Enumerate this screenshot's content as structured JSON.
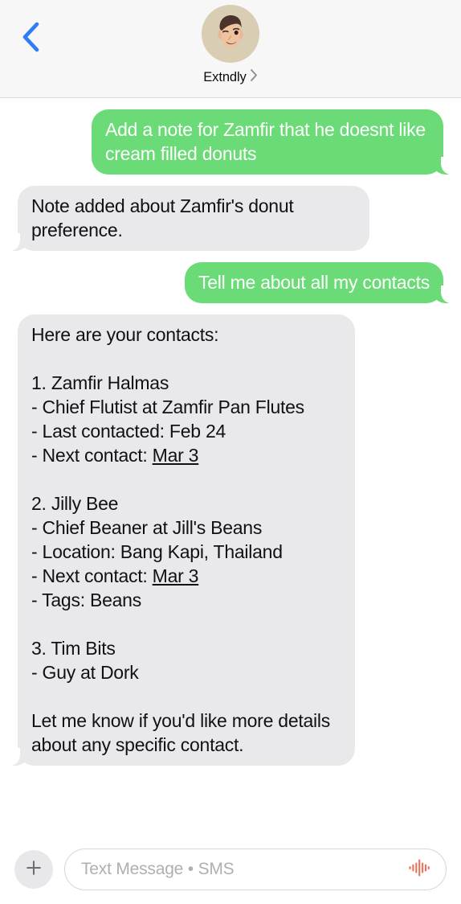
{
  "header": {
    "back_icon": "chevron-left-icon",
    "back_color": "#2F7CF6",
    "avatar_icon": "memoji-avatar",
    "avatar_bg": "#D9CDB3",
    "contact_name": "Extndly",
    "detail_chevron_icon": "chevron-right-icon"
  },
  "conversation": {
    "messages": [
      {
        "id": "msg-1",
        "direction": "outgoing",
        "service": "SMS",
        "text": "Add a note for Zamfir that he doesnt like cream filled donuts"
      },
      {
        "id": "msg-2",
        "direction": "incoming",
        "text": "Note added about Zamfir's donut preference."
      },
      {
        "id": "msg-3",
        "direction": "outgoing",
        "service": "SMS",
        "text": "Tell me about all my contacts"
      },
      {
        "id": "msg-4",
        "direction": "incoming",
        "intro": "Here are your contacts:",
        "contacts": [
          {
            "index": "1.",
            "name": "Zamfir Halmas",
            "lines": [
              {
                "text": "- Chief Flutist at Zamfir Pan Flutes"
              },
              {
                "text": "- Last contacted: Feb 24"
              },
              {
                "prefix": "- Next contact: ",
                "link": "Mar 3"
              }
            ]
          },
          {
            "index": "2.",
            "name": "Jilly Bee",
            "lines": [
              {
                "text": "- Chief Beaner at Jill's Beans"
              },
              {
                "text": "- Location: Bang Kapi, Thailand"
              },
              {
                "prefix": "- Next contact: ",
                "link": "Mar 3"
              },
              {
                "text": "- Tags: Beans"
              }
            ]
          },
          {
            "index": "3.",
            "name": "Tim Bits",
            "lines": [
              {
                "text": "- Guy at Dork"
              }
            ]
          }
        ],
        "outro": "Let me know if you'd like more details about any specific contact."
      }
    ]
  },
  "input_bar": {
    "plus_icon": "plus-icon",
    "placeholder": "Text Message • SMS",
    "value": "",
    "audio_icon": "audio-waveform-icon",
    "audio_icon_color": "#F0705A"
  },
  "colors": {
    "outgoing_bubble": "#6ADB76",
    "incoming_bubble": "#E9E9EB",
    "accent_blue": "#2F7CF6",
    "header_bg": "#F7F7F7"
  }
}
